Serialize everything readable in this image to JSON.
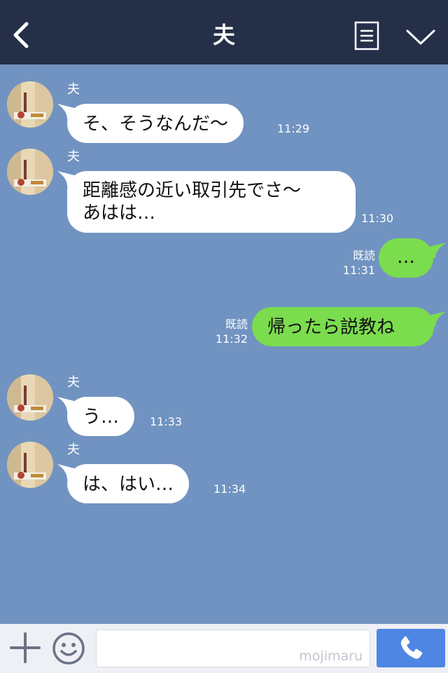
{
  "header": {
    "title": "夫"
  },
  "messages": [
    {
      "sender": "夫",
      "text": "そ、そうなんだ〜",
      "time": "11:29"
    },
    {
      "sender": "夫",
      "text": "距離感の近い取引先でさ〜\nあはは…",
      "time": "11:30"
    },
    {
      "read": "既読",
      "text": "…",
      "time": "11:31"
    },
    {
      "read": "既読",
      "text": "帰ったら説教ね",
      "time": "11:32"
    },
    {
      "sender": "夫",
      "text": "う…",
      "time": "11:33"
    },
    {
      "sender": "夫",
      "text": "は、はい…",
      "time": "11:34"
    }
  ],
  "input": {
    "watermark": "mojimaru"
  },
  "colors": {
    "header_bg": "#253048",
    "chat_bg": "#7193c1",
    "incoming_bubble": "#ffffff",
    "outgoing_bubble": "#7bdc4e",
    "call_button": "#4f86e4"
  },
  "icons": [
    "back-icon",
    "menu-icon",
    "chevron-down-icon",
    "plus-icon",
    "emoji-icon",
    "phone-icon"
  ]
}
